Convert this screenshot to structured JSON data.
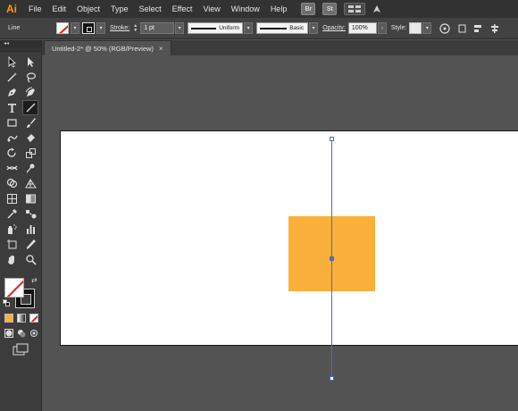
{
  "app": {
    "logo": "Ai"
  },
  "menu": [
    "File",
    "Edit",
    "Object",
    "Type",
    "Select",
    "Effect",
    "View",
    "Window",
    "Help"
  ],
  "menu_buttons": {
    "bridge": "Br",
    "stock": "St"
  },
  "control": {
    "tool_name": "Line",
    "stroke_label": "Stroke:",
    "stroke_weight": "1 pt",
    "profile": "Uniform",
    "brush": "Basic",
    "opacity_label": "Opacity:",
    "opacity_value": "100%",
    "style_label": "Style:"
  },
  "document": {
    "tab_title": "Untitled-2* @ 50% (RGB/Preview)",
    "close": "×"
  },
  "panel_collapse": "◂◂",
  "colors": {
    "rect_fill": "#fbb03b",
    "selection": "#4a6fb5",
    "artboard": "#ffffff"
  },
  "tools": [
    "selection-tool",
    "direct-selection-tool",
    "magic-wand-tool",
    "lasso-tool",
    "pen-tool",
    "curvature-tool",
    "type-tool",
    "line-segment-tool",
    "rectangle-tool",
    "paintbrush-tool",
    "shaper-tool",
    "eraser-tool",
    "rotate-tool",
    "scale-tool",
    "width-tool",
    "puppet-warp-tool",
    "shape-builder-tool",
    "perspective-grid-tool",
    "mesh-tool",
    "gradient-tool",
    "eyedropper-tool",
    "blend-tool",
    "symbol-sprayer-tool",
    "column-graph-tool",
    "artboard-tool",
    "slice-tool",
    "hand-tool",
    "zoom-tool"
  ]
}
